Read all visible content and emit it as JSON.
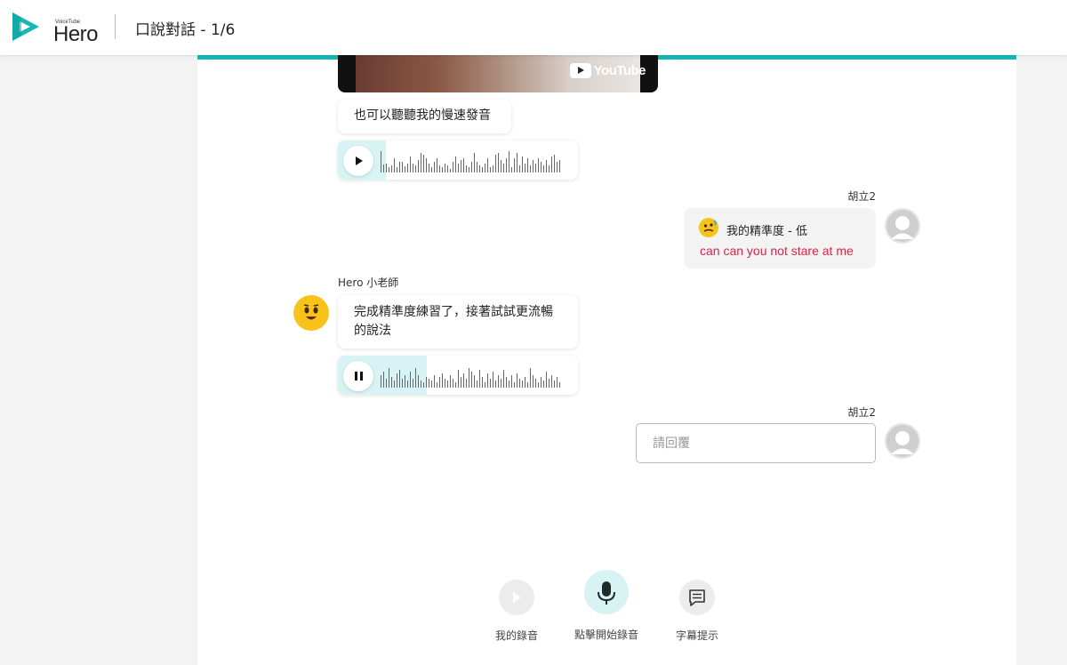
{
  "header": {
    "logo_sub": "VoiceTube",
    "logo_main": "Hero",
    "title": "口說對話 - 1/6"
  },
  "video": {
    "youtube_label": "YouTube"
  },
  "messages": {
    "slow_prompt": "也可以聽聽我的慢速發音",
    "user1_name": "胡立2",
    "score_label": "我的精準度 - 低",
    "user1_transcript": "can can you not stare at me",
    "hero_name": "Hero 小老師",
    "hero_text_line1": "完成精準度練習了，接著試試更流暢",
    "hero_text_line2": "的說法",
    "user2_name": "胡立2"
  },
  "audio_players": [
    {
      "state": "paused",
      "progress": 0.2
    },
    {
      "state": "playing",
      "progress": 0.37
    }
  ],
  "reply": {
    "placeholder": "請回覆",
    "value": ""
  },
  "controls": {
    "my_recording": "我的錄音",
    "start_recording": "點擊開始錄音",
    "subtitle_hint": "字幕提示"
  },
  "colors": {
    "accent": "#16b8b8",
    "accent_light": "#d8f3f3",
    "error_text": "#d6254a",
    "hero_avatar": "#f7c21a"
  }
}
